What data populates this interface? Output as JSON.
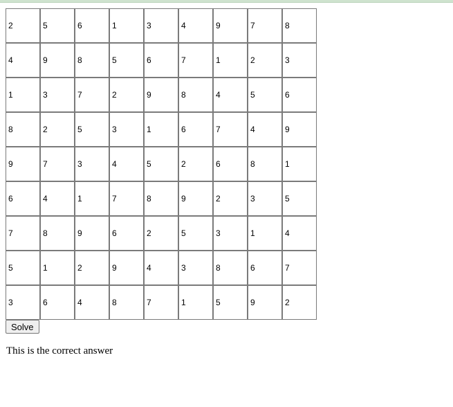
{
  "grid": [
    [
      "2",
      "5",
      "6",
      "1",
      "3",
      "4",
      "9",
      "7",
      "8"
    ],
    [
      "4",
      "9",
      "8",
      "5",
      "6",
      "7",
      "1",
      "2",
      "3"
    ],
    [
      "1",
      "3",
      "7",
      "2",
      "9",
      "8",
      "4",
      "5",
      "6"
    ],
    [
      "8",
      "2",
      "5",
      "3",
      "1",
      "6",
      "7",
      "4",
      "9"
    ],
    [
      "9",
      "7",
      "3",
      "4",
      "5",
      "2",
      "6",
      "8",
      "1"
    ],
    [
      "6",
      "4",
      "1",
      "7",
      "8",
      "9",
      "2",
      "3",
      "5"
    ],
    [
      "7",
      "8",
      "9",
      "6",
      "2",
      "5",
      "3",
      "1",
      "4"
    ],
    [
      "5",
      "1",
      "2",
      "9",
      "4",
      "3",
      "8",
      "6",
      "7"
    ],
    [
      "3",
      "6",
      "4",
      "8",
      "7",
      "1",
      "5",
      "9",
      "2"
    ]
  ],
  "solve_label": "Solve",
  "status_text": "This is the correct answer"
}
